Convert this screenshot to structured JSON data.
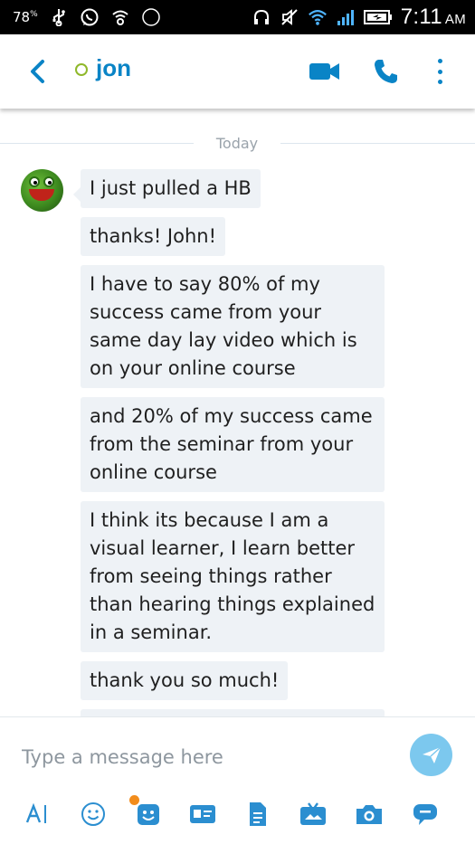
{
  "status_bar": {
    "battery_percent": "78",
    "battery_percent_sup": "%",
    "notification_badge": "78",
    "time": "7:11",
    "ampm": "AM"
  },
  "header": {
    "contact_name": "jon",
    "accent_color": "#0a84c6",
    "presence_color": "#8fb82a"
  },
  "conversation": {
    "date_label": "Today",
    "messages": [
      {
        "text": "I just pulled a HB"
      },
      {
        "text": "thanks! John!"
      },
      {
        "text": "I have to say 80% of my success came from your same day lay video which is on your online course"
      },
      {
        "text": "and 20% of my success came from the seminar from your online course"
      },
      {
        "text": "I think its because I am a visual learner, I learn better from seeing things rather than hearing things explained in a seminar."
      },
      {
        "text": "thank you so much!"
      }
    ]
  },
  "compose": {
    "placeholder": "Type a message here",
    "send_color": "#7cc8ee"
  },
  "toolbar": {
    "icons": [
      "text-format-icon",
      "emoticon-icon",
      "mojis-icon",
      "contact-card-icon",
      "file-icon",
      "media-bar-icon",
      "camera-icon",
      "chat-bubble-icon"
    ],
    "notification_dot_color": "#f28c1c"
  }
}
